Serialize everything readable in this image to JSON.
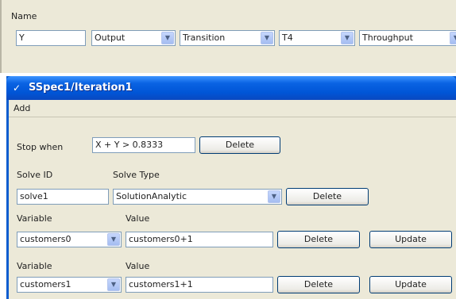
{
  "top_panel": {
    "name_label": "Name",
    "name_value": "Y",
    "direction_value": "Output",
    "element_type_value": "Transition",
    "element_value": "T4",
    "metric_value": "Throughput"
  },
  "window": {
    "title": "SSpec1/Iteration1",
    "menu_add": "Add"
  },
  "stop": {
    "label": "Stop when",
    "value": "X + Y > 0.8333",
    "delete_label": "Delete"
  },
  "solve": {
    "id_label": "Solve ID",
    "type_label": "Solve Type",
    "id_value": "solve1",
    "type_value": "SolutionAnalytic",
    "delete_label": "Delete"
  },
  "variables": [
    {
      "variable_label": "Variable",
      "value_label": "Value",
      "variable": "customers0",
      "value": "customers0+1",
      "delete_label": "Delete",
      "update_label": "Update"
    },
    {
      "variable_label": "Variable",
      "value_label": "Value",
      "variable": "customers1",
      "value": "customers1+1",
      "delete_label": "Delete",
      "update_label": "Update"
    }
  ],
  "icons": {
    "title": "check-icon",
    "dropdown": "chevron-down-icon"
  },
  "colors": {
    "titlebar": "#0055d6",
    "panel": "#ece9d8",
    "field_border": "#7f9db9"
  }
}
